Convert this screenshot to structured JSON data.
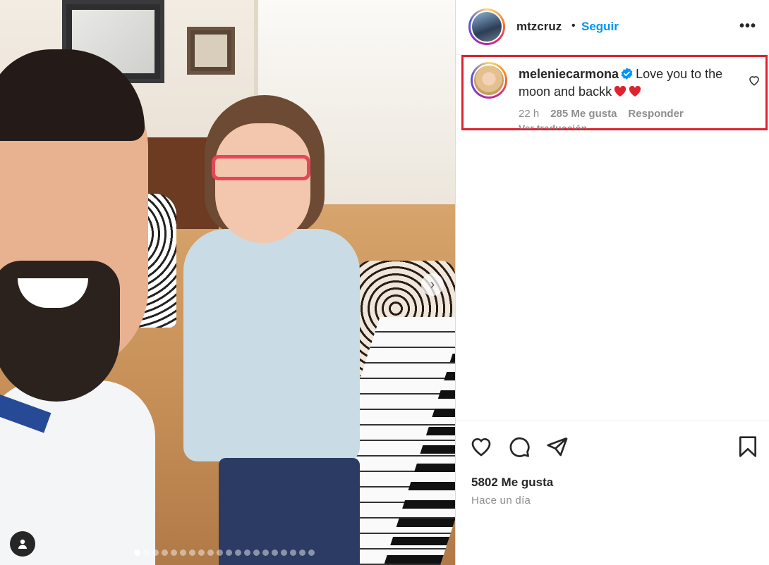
{
  "post": {
    "username": "mtzcruz",
    "separator": "•",
    "follow_label": "Seguir",
    "more_label": "•••"
  },
  "comment": {
    "username": "meleniecarmona",
    "text": "Love you to the moon and backk",
    "time": "22 h",
    "likes": "285 Me gusta",
    "reply_label": "Responder",
    "translate_label": "Ver traducción"
  },
  "carousel": {
    "total_slides": 20,
    "active_index": 0
  },
  "footer": {
    "likes": "5802 Me gusta",
    "posted": "Hace un día"
  },
  "colors": {
    "accent": "#0095f6",
    "highlight_border": "#e0212f",
    "heart_emoji": "#e0212f"
  }
}
